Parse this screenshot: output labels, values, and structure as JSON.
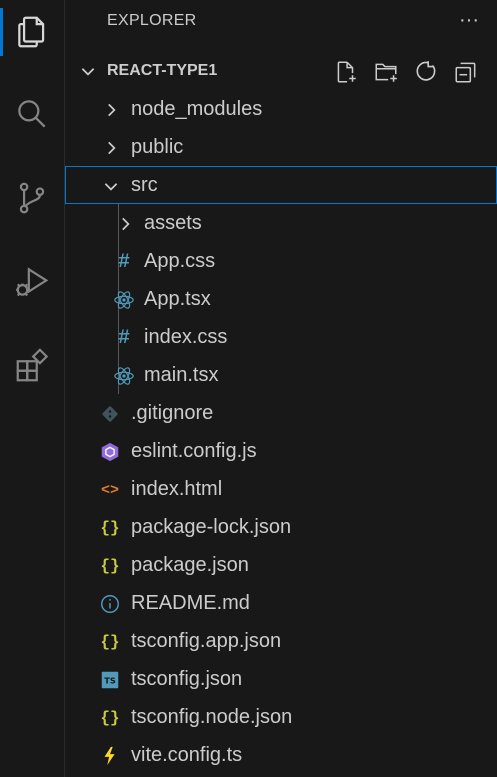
{
  "explorer": {
    "title": "EXPLORER",
    "more_label": "···"
  },
  "project": {
    "name": "REACT-TYPE1"
  },
  "activity_bar": [
    {
      "name": "explorer-icon",
      "active": true
    },
    {
      "name": "search-icon",
      "active": false
    },
    {
      "name": "source-control-icon",
      "active": false
    },
    {
      "name": "run-debug-icon",
      "active": false
    },
    {
      "name": "extensions-icon",
      "active": false
    }
  ],
  "tree": [
    {
      "label": "node_modules",
      "kind": "folder",
      "expanded": false,
      "depth": 0,
      "icon": "chevron-right-icon"
    },
    {
      "label": "public",
      "kind": "folder",
      "expanded": false,
      "depth": 0,
      "icon": "chevron-right-icon"
    },
    {
      "label": "src",
      "kind": "folder",
      "expanded": true,
      "depth": 0,
      "icon": "chevron-down-icon",
      "focused": true
    },
    {
      "label": "assets",
      "kind": "folder",
      "expanded": false,
      "depth": 1,
      "icon": "chevron-right-icon"
    },
    {
      "label": "App.css",
      "kind": "file",
      "depth": 1,
      "icon": "css-icon"
    },
    {
      "label": "App.tsx",
      "kind": "file",
      "depth": 1,
      "icon": "react-icon"
    },
    {
      "label": "index.css",
      "kind": "file",
      "depth": 1,
      "icon": "css-icon"
    },
    {
      "label": "main.tsx",
      "kind": "file",
      "depth": 1,
      "icon": "react-icon"
    },
    {
      "label": ".gitignore",
      "kind": "file",
      "depth": 0,
      "icon": "git-icon"
    },
    {
      "label": "eslint.config.js",
      "kind": "file",
      "depth": 0,
      "icon": "eslint-icon"
    },
    {
      "label": "index.html",
      "kind": "file",
      "depth": 0,
      "icon": "html-icon"
    },
    {
      "label": "package-lock.json",
      "kind": "file",
      "depth": 0,
      "icon": "json-icon"
    },
    {
      "label": "package.json",
      "kind": "file",
      "depth": 0,
      "icon": "json-icon"
    },
    {
      "label": "README.md",
      "kind": "file",
      "depth": 0,
      "icon": "info-icon"
    },
    {
      "label": "tsconfig.app.json",
      "kind": "file",
      "depth": 0,
      "icon": "json-icon"
    },
    {
      "label": "tsconfig.json",
      "kind": "file",
      "depth": 0,
      "icon": "tsconfig-icon"
    },
    {
      "label": "tsconfig.node.json",
      "kind": "file",
      "depth": 0,
      "icon": "json-icon"
    },
    {
      "label": "vite.config.ts",
      "kind": "file",
      "depth": 0,
      "icon": "vite-icon"
    }
  ],
  "icon_glyphs": {
    "css": "#",
    "json": "{ }",
    "html": "<>",
    "ts": "TS"
  },
  "colors": {
    "background": "#181818",
    "text": "#cccccc",
    "focus_border": "#0078d4",
    "css": "#519aba",
    "react": "#519aba",
    "json": "#cbcb41",
    "html": "#e37933",
    "eslint": "#8f6bdb",
    "git": "#41535b",
    "info": "#519aba",
    "ts": "#519aba",
    "vite": "#ffd62e"
  }
}
